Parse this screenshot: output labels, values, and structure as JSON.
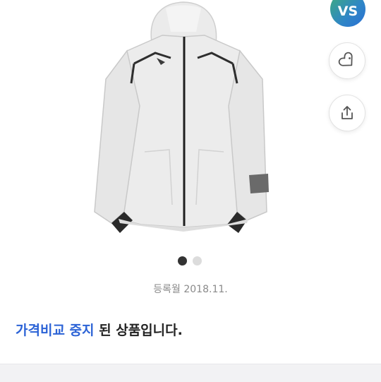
{
  "top_actions": {
    "vs_label": "VS",
    "wishlist_icon": "heart-tag-icon",
    "share_icon": "share-icon"
  },
  "gallery": {
    "image": "white zip-up hooded jacket",
    "page_count": 2,
    "current_page": 1
  },
  "product": {
    "registered_date": "등록월 2018.11.",
    "status_highlight": "가격비교 중지",
    "status_rest": " 된 상품입니다."
  },
  "colors": {
    "accent_blue": "#2c63d6",
    "text_dark": "#222222",
    "text_muted": "#8a8a8a"
  }
}
